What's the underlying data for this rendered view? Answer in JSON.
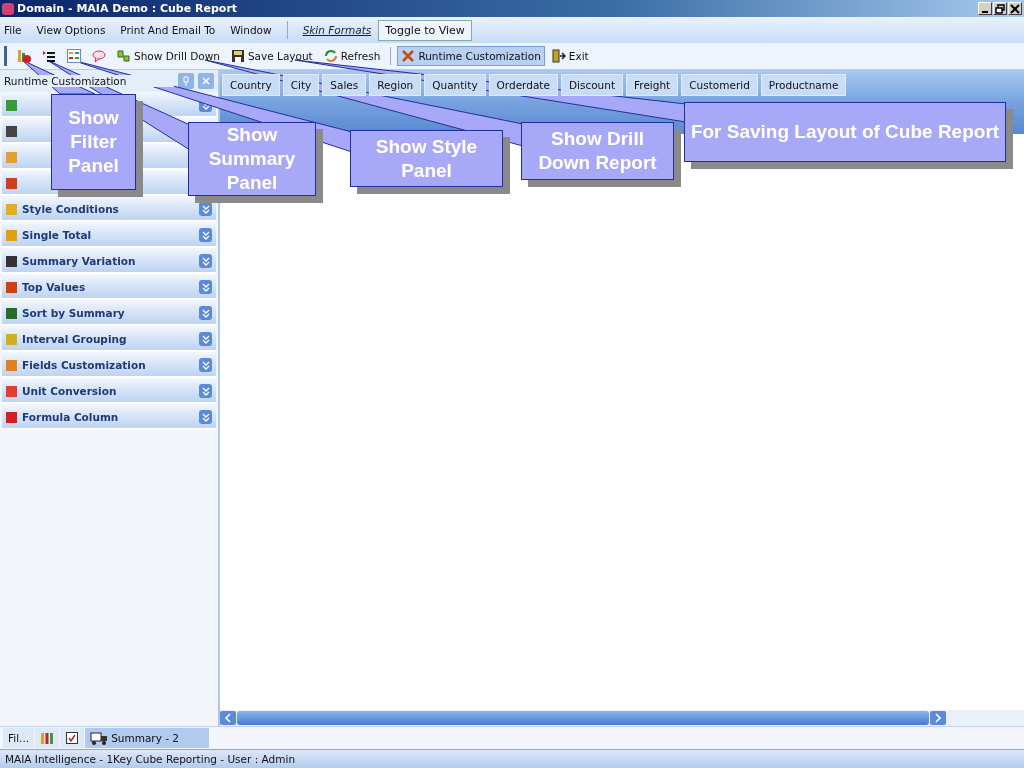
{
  "window": {
    "title": "Domain - MAIA Demo : Cube Report"
  },
  "menu": [
    {
      "label": "File",
      "kind": "menu"
    },
    {
      "label": "View Options",
      "kind": "menu"
    },
    {
      "label": "Print And Email To",
      "kind": "menu"
    },
    {
      "label": "Window",
      "kind": "menu"
    },
    {
      "label": "Skin Formats",
      "kind": "link"
    },
    {
      "label": "Toggle to View",
      "kind": "button"
    }
  ],
  "toolbar": [
    {
      "kind": "filter",
      "selected": false
    },
    {
      "kind": "summary",
      "selected": false
    },
    {
      "kind": "style",
      "selected": false
    },
    {
      "kind": "comment",
      "selected": false
    },
    {
      "kind": "drill",
      "label": "Show Drill Down",
      "selected": false
    },
    {
      "kind": "save",
      "label": "Save Layout",
      "selected": false
    },
    {
      "kind": "refresh",
      "label": "Refresh",
      "selected": false
    },
    {
      "kind": "tools",
      "label": "Runtime Customization",
      "selected": true
    },
    {
      "kind": "exit",
      "label": "Exit",
      "selected": false
    }
  ],
  "side_panel": {
    "title": "Runtime Customization",
    "items": [
      "Style Conditions",
      "Single Total",
      "Summary Variation",
      "Top Values",
      "Sort by Summary",
      "Interval Grouping",
      "Fields Customization",
      "Unit Conversion",
      "Formula Column"
    ]
  },
  "fields": [
    "Country",
    "City",
    "Sales",
    "Region",
    "Quantity",
    "Orderdate",
    "Discount",
    "Freight",
    "Customerid",
    "Productname"
  ],
  "bottom_tabs": [
    {
      "kind": "text",
      "label": "Fil...",
      "selected": false
    },
    {
      "kind": "bars",
      "selected": false
    },
    {
      "kind": "check",
      "selected": false
    },
    {
      "kind": "truck",
      "label": "Summary - 2",
      "selected": true
    }
  ],
  "status_bar": "MAIA Intelligence - 1Key Cube Reporting - User : Admin",
  "callouts": [
    {
      "text": "Show Filter Panel",
      "kind": "filter"
    },
    {
      "text": "Show Summary Panel",
      "kind": "summary"
    },
    {
      "text": "Show Style Panel",
      "kind": "style"
    },
    {
      "text": "Show Drill Down Report",
      "kind": "drill"
    },
    {
      "text": "For Saving Layout of Cube Report",
      "kind": "save"
    }
  ]
}
